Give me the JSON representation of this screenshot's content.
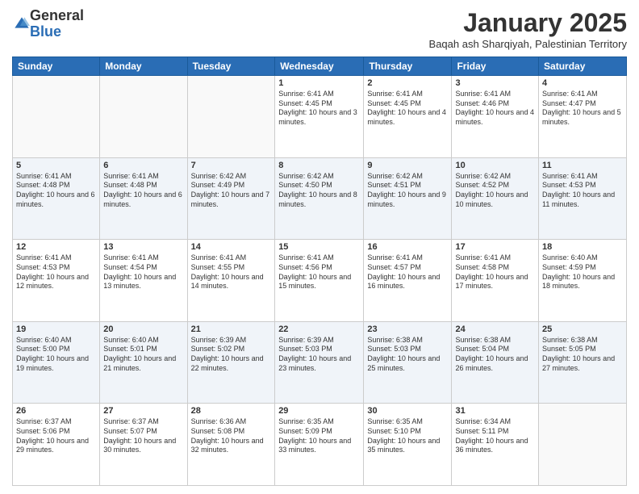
{
  "logo": {
    "general": "General",
    "blue": "Blue"
  },
  "header": {
    "month_title": "January 2025",
    "location": "Baqah ash Sharqiyah, Palestinian Territory"
  },
  "weekdays": [
    "Sunday",
    "Monday",
    "Tuesday",
    "Wednesday",
    "Thursday",
    "Friday",
    "Saturday"
  ],
  "weeks": [
    [
      {
        "day": "",
        "info": ""
      },
      {
        "day": "",
        "info": ""
      },
      {
        "day": "",
        "info": ""
      },
      {
        "day": "1",
        "info": "Sunrise: 6:41 AM\nSunset: 4:45 PM\nDaylight: 10 hours and 3 minutes."
      },
      {
        "day": "2",
        "info": "Sunrise: 6:41 AM\nSunset: 4:45 PM\nDaylight: 10 hours and 4 minutes."
      },
      {
        "day": "3",
        "info": "Sunrise: 6:41 AM\nSunset: 4:46 PM\nDaylight: 10 hours and 4 minutes."
      },
      {
        "day": "4",
        "info": "Sunrise: 6:41 AM\nSunset: 4:47 PM\nDaylight: 10 hours and 5 minutes."
      }
    ],
    [
      {
        "day": "5",
        "info": "Sunrise: 6:41 AM\nSunset: 4:48 PM\nDaylight: 10 hours and 6 minutes."
      },
      {
        "day": "6",
        "info": "Sunrise: 6:41 AM\nSunset: 4:48 PM\nDaylight: 10 hours and 6 minutes."
      },
      {
        "day": "7",
        "info": "Sunrise: 6:42 AM\nSunset: 4:49 PM\nDaylight: 10 hours and 7 minutes."
      },
      {
        "day": "8",
        "info": "Sunrise: 6:42 AM\nSunset: 4:50 PM\nDaylight: 10 hours and 8 minutes."
      },
      {
        "day": "9",
        "info": "Sunrise: 6:42 AM\nSunset: 4:51 PM\nDaylight: 10 hours and 9 minutes."
      },
      {
        "day": "10",
        "info": "Sunrise: 6:42 AM\nSunset: 4:52 PM\nDaylight: 10 hours and 10 minutes."
      },
      {
        "day": "11",
        "info": "Sunrise: 6:41 AM\nSunset: 4:53 PM\nDaylight: 10 hours and 11 minutes."
      }
    ],
    [
      {
        "day": "12",
        "info": "Sunrise: 6:41 AM\nSunset: 4:53 PM\nDaylight: 10 hours and 12 minutes."
      },
      {
        "day": "13",
        "info": "Sunrise: 6:41 AM\nSunset: 4:54 PM\nDaylight: 10 hours and 13 minutes."
      },
      {
        "day": "14",
        "info": "Sunrise: 6:41 AM\nSunset: 4:55 PM\nDaylight: 10 hours and 14 minutes."
      },
      {
        "day": "15",
        "info": "Sunrise: 6:41 AM\nSunset: 4:56 PM\nDaylight: 10 hours and 15 minutes."
      },
      {
        "day": "16",
        "info": "Sunrise: 6:41 AM\nSunset: 4:57 PM\nDaylight: 10 hours and 16 minutes."
      },
      {
        "day": "17",
        "info": "Sunrise: 6:41 AM\nSunset: 4:58 PM\nDaylight: 10 hours and 17 minutes."
      },
      {
        "day": "18",
        "info": "Sunrise: 6:40 AM\nSunset: 4:59 PM\nDaylight: 10 hours and 18 minutes."
      }
    ],
    [
      {
        "day": "19",
        "info": "Sunrise: 6:40 AM\nSunset: 5:00 PM\nDaylight: 10 hours and 19 minutes."
      },
      {
        "day": "20",
        "info": "Sunrise: 6:40 AM\nSunset: 5:01 PM\nDaylight: 10 hours and 21 minutes."
      },
      {
        "day": "21",
        "info": "Sunrise: 6:39 AM\nSunset: 5:02 PM\nDaylight: 10 hours and 22 minutes."
      },
      {
        "day": "22",
        "info": "Sunrise: 6:39 AM\nSunset: 5:03 PM\nDaylight: 10 hours and 23 minutes."
      },
      {
        "day": "23",
        "info": "Sunrise: 6:38 AM\nSunset: 5:03 PM\nDaylight: 10 hours and 25 minutes."
      },
      {
        "day": "24",
        "info": "Sunrise: 6:38 AM\nSunset: 5:04 PM\nDaylight: 10 hours and 26 minutes."
      },
      {
        "day": "25",
        "info": "Sunrise: 6:38 AM\nSunset: 5:05 PM\nDaylight: 10 hours and 27 minutes."
      }
    ],
    [
      {
        "day": "26",
        "info": "Sunrise: 6:37 AM\nSunset: 5:06 PM\nDaylight: 10 hours and 29 minutes."
      },
      {
        "day": "27",
        "info": "Sunrise: 6:37 AM\nSunset: 5:07 PM\nDaylight: 10 hours and 30 minutes."
      },
      {
        "day": "28",
        "info": "Sunrise: 6:36 AM\nSunset: 5:08 PM\nDaylight: 10 hours and 32 minutes."
      },
      {
        "day": "29",
        "info": "Sunrise: 6:35 AM\nSunset: 5:09 PM\nDaylight: 10 hours and 33 minutes."
      },
      {
        "day": "30",
        "info": "Sunrise: 6:35 AM\nSunset: 5:10 PM\nDaylight: 10 hours and 35 minutes."
      },
      {
        "day": "31",
        "info": "Sunrise: 6:34 AM\nSunset: 5:11 PM\nDaylight: 10 hours and 36 minutes."
      },
      {
        "day": "",
        "info": ""
      }
    ]
  ]
}
